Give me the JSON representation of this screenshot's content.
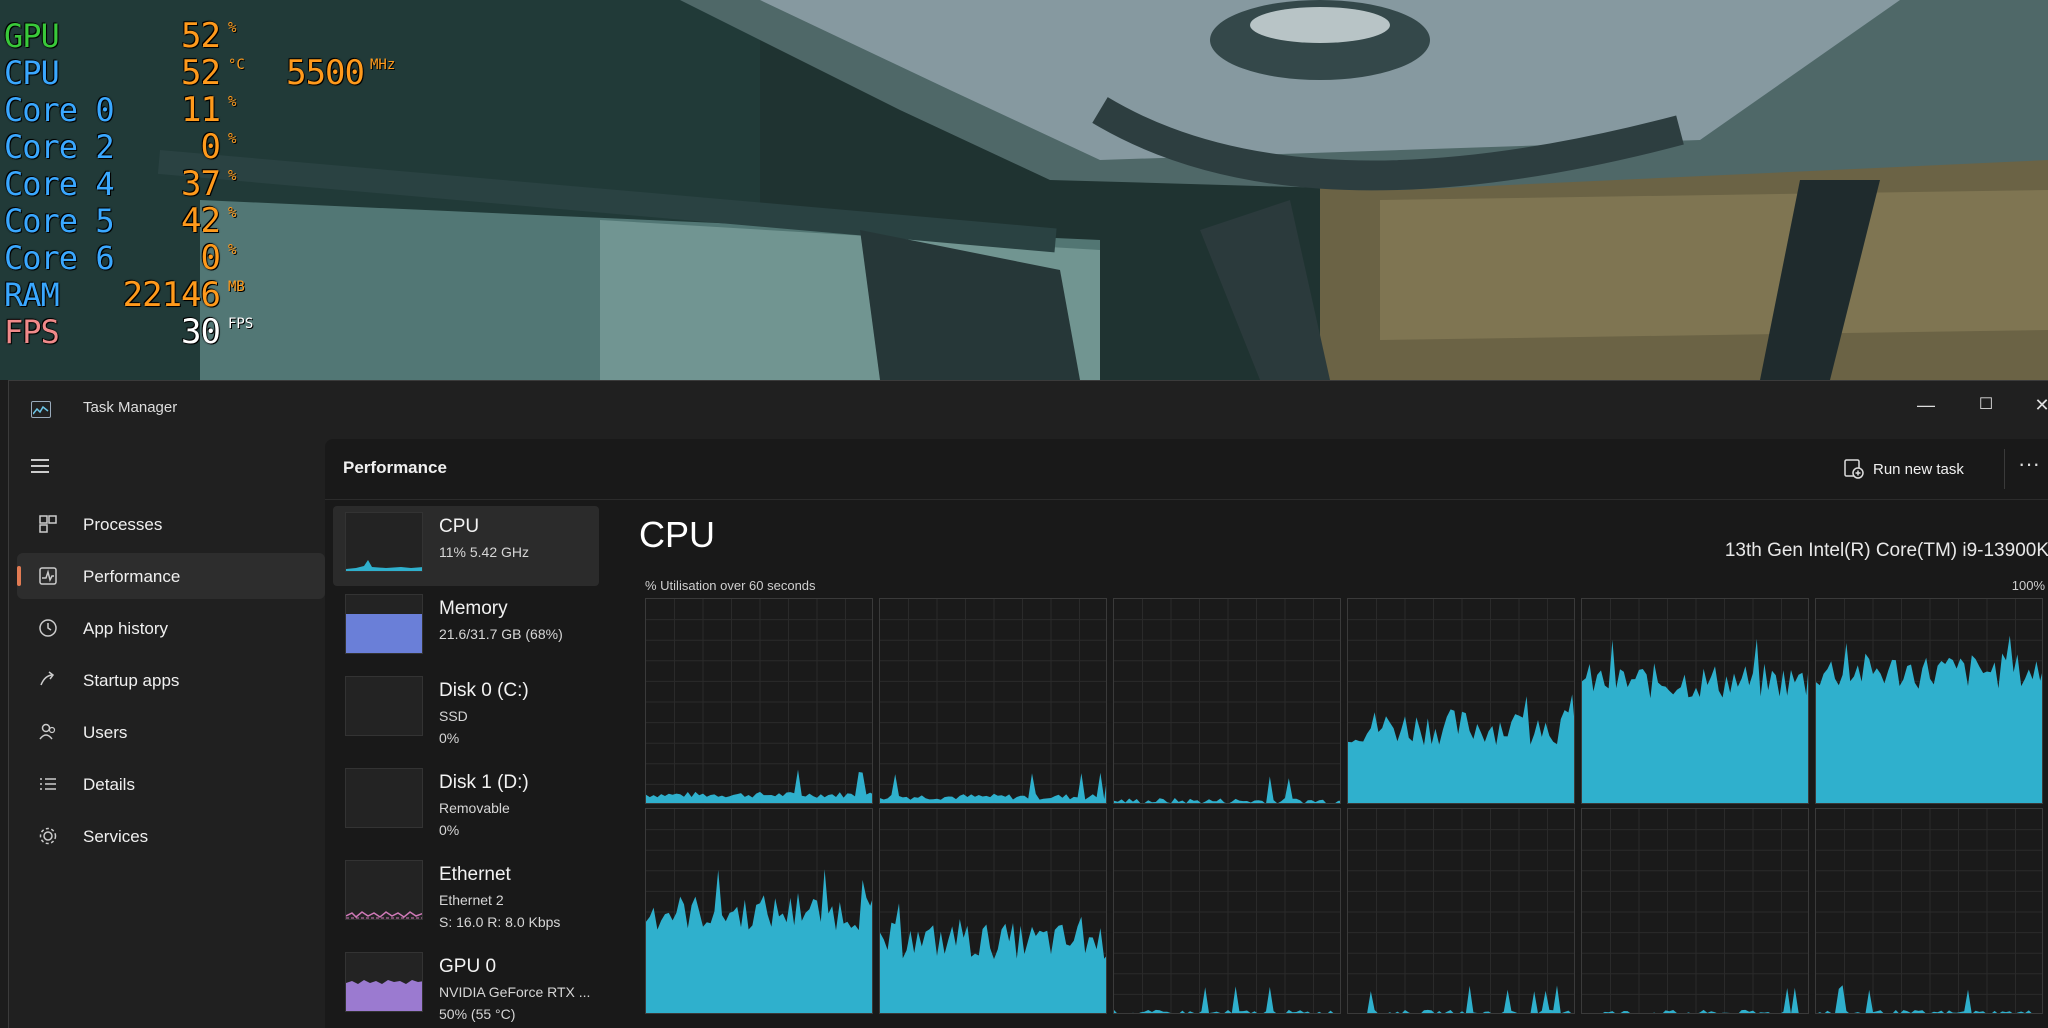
{
  "osd": [
    {
      "label": "GPU",
      "value": "52",
      "unit": "%",
      "label_color": "#39c93a"
    },
    {
      "label": "CPU",
      "value": "52",
      "unit": "°C",
      "label_color": "#3aa8ff",
      "extra_value": "5500",
      "extra_unit": "MHz"
    },
    {
      "label": "Core 0",
      "value": "11",
      "unit": "%",
      "label_color": "#3aa8ff"
    },
    {
      "label": "Core 2",
      "value": "0",
      "unit": "%",
      "label_color": "#3aa8ff"
    },
    {
      "label": "Core 4",
      "value": "37",
      "unit": "%",
      "label_color": "#3aa8ff"
    },
    {
      "label": "Core 5",
      "value": "42",
      "unit": "%",
      "label_color": "#3aa8ff"
    },
    {
      "label": "Core 6",
      "value": "0",
      "unit": "%",
      "label_color": "#3aa8ff"
    },
    {
      "label": "RAM",
      "value": "22146",
      "unit": "MB",
      "label_color": "#3aa8ff"
    },
    {
      "label": "FPS",
      "value": "30",
      "unit": "FPS",
      "label_color": "#f08a8a",
      "value_color": "#ffffff"
    }
  ],
  "window": {
    "title": "Task Manager",
    "minimize": "—",
    "maximize": "☐",
    "close": "✕"
  },
  "sidebar": {
    "items": [
      {
        "label": "Processes",
        "icon": "processes-icon"
      },
      {
        "label": "Performance",
        "icon": "performance-icon",
        "active": true
      },
      {
        "label": "App history",
        "icon": "history-icon"
      },
      {
        "label": "Startup apps",
        "icon": "startup-icon"
      },
      {
        "label": "Users",
        "icon": "users-icon"
      },
      {
        "label": "Details",
        "icon": "details-icon"
      },
      {
        "label": "Services",
        "icon": "services-icon"
      }
    ]
  },
  "header": {
    "title": "Performance",
    "run_new_task": "Run new task",
    "more": "···"
  },
  "devices": [
    {
      "name": "CPU",
      "sub1": "11%  5.42 GHz",
      "sub2": "",
      "active": true
    },
    {
      "name": "Memory",
      "sub1": "21.6/31.7 GB (68%)",
      "sub2": ""
    },
    {
      "name": "Disk 0 (C:)",
      "sub1": "SSD",
      "sub2": "0%"
    },
    {
      "name": "Disk 1 (D:)",
      "sub1": "Removable",
      "sub2": "0%"
    },
    {
      "name": "Ethernet",
      "sub1": "Ethernet 2",
      "sub2": "S: 16.0  R: 8.0 Kbps"
    },
    {
      "name": "GPU 0",
      "sub1": "NVIDIA GeForce RTX ...",
      "sub2": "50% (55 °C)"
    }
  ],
  "cpu": {
    "title": "CPU",
    "model": "13th Gen Intel(R) Core(TM) i9-13900K",
    "util_label": "% Utilisation over 60 seconds",
    "util_max": "100%",
    "graph_color": "#2fb0cd",
    "core_levels": [
      0.05,
      0.04,
      0.02,
      0.38,
      0.6,
      0.65,
      0.5,
      0.36,
      0.01,
      0.01,
      0.01,
      0.01
    ]
  },
  "colors": {
    "accent": "#e27b53",
    "graph": "#2fb0cd",
    "memory": "#6a7fd8",
    "gpu": "#9b7ad0"
  }
}
